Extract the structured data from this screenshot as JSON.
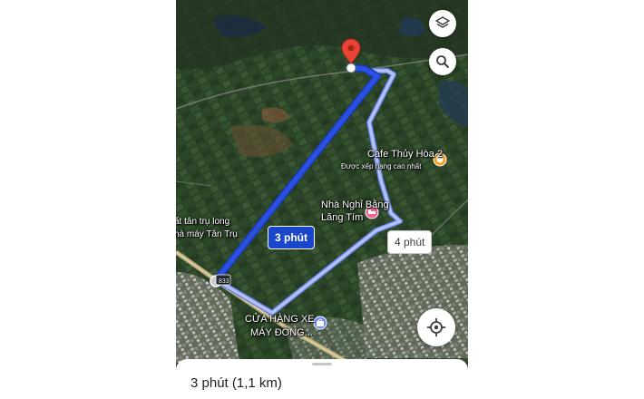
{
  "colors": {
    "route_main": "#2b50e0",
    "route_alt": "#a9b5f5",
    "chip_main_bg": "#1a47c9",
    "destination_pin": "#ea4335",
    "cafe_icon": "#f4a21f",
    "motel_icon": "#f06292",
    "shop_icon": "#6e8cf0"
  },
  "icons": {
    "layers": "layers-icon",
    "search": "search-icon",
    "locate": "my-location-icon",
    "destination": "destination-pin-icon"
  },
  "routes": {
    "main_label": "3 phút",
    "alt_label": "4 phút"
  },
  "places": {
    "cafe_name": "Cafe Thủy Hòa 2",
    "cafe_sub": "Được xếp hạng cao nhất",
    "motel_name": "Nhà Nghỉ Bằng",
    "motel_sub": "Lăng Tím",
    "left_line1": "ất tân trụ long",
    "left_line2": "hà máy Tân Trụ",
    "shop_name": "CỬA HÀNG XE",
    "shop_sub": "MÁY ĐÔNG...",
    "road_number": "833"
  },
  "sheet": {
    "duration": "3 phút",
    "distance": "(1,1 km)"
  }
}
